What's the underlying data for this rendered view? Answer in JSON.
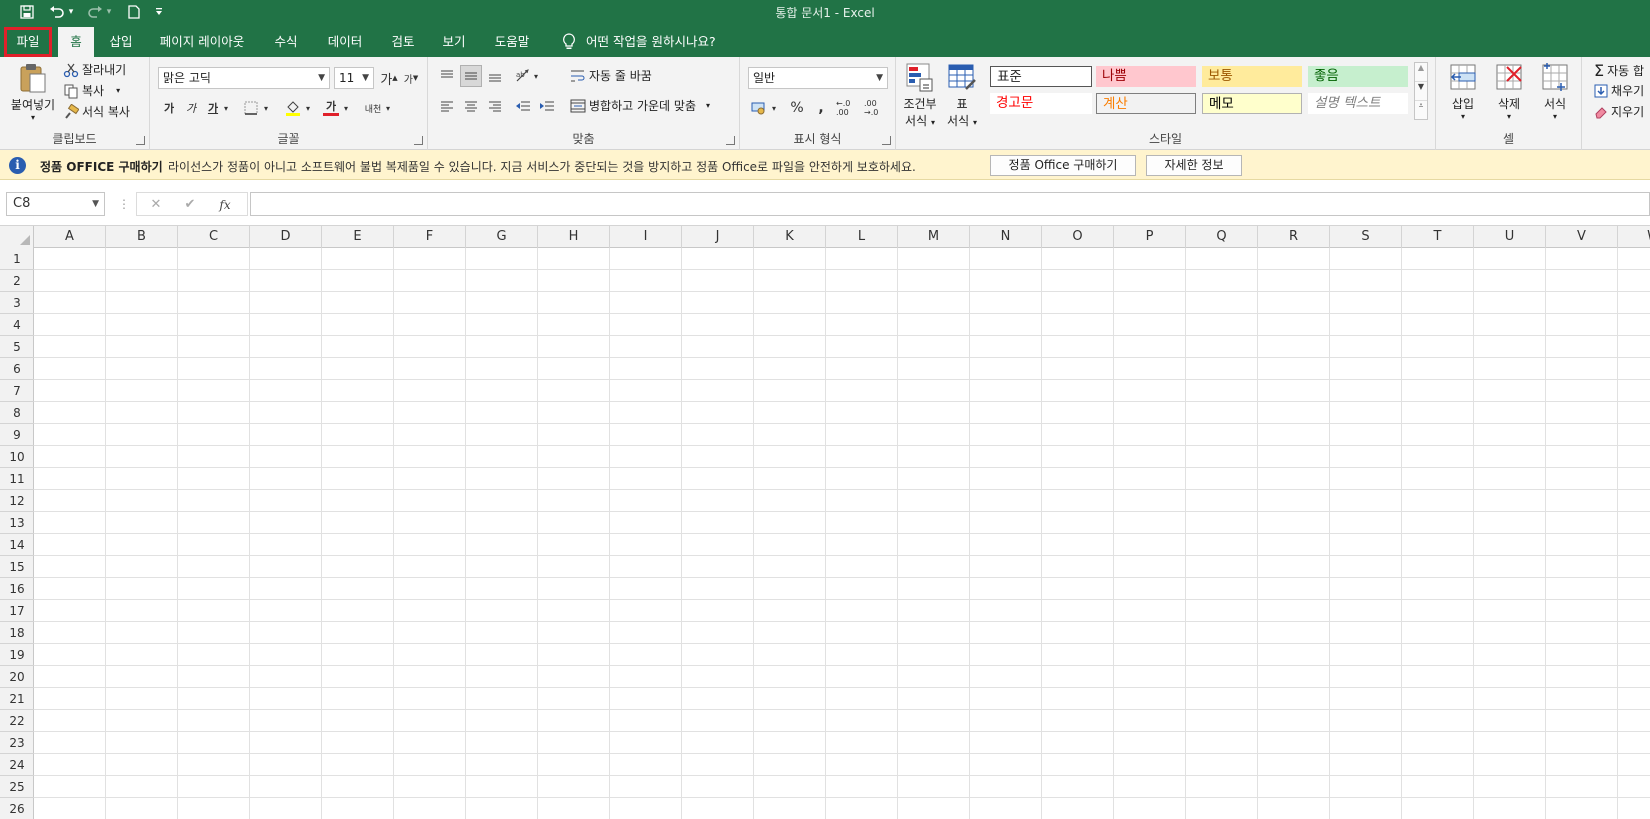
{
  "titlebar": {
    "title": "통합 문서1  -  Excel",
    "quick_access": [
      "save-icon",
      "undo-icon",
      "redo-icon",
      "new-document-icon",
      "customize-arrow-icon"
    ]
  },
  "tabs": [
    {
      "label": "파일"
    },
    {
      "label": "홈"
    },
    {
      "label": "삽입"
    },
    {
      "label": "페이지 레이아웃"
    },
    {
      "label": "수식"
    },
    {
      "label": "데이터"
    },
    {
      "label": "검토"
    },
    {
      "label": "보기"
    },
    {
      "label": "도움말"
    }
  ],
  "tellme": {
    "label": "어떤 작업을 원하시나요?"
  },
  "ribbon": {
    "clipboard": {
      "label": "클립보드",
      "paste": "붙여넣기",
      "cut": "잘라내기",
      "copy": "복사",
      "format_painter": "서식 복사"
    },
    "font": {
      "label": "글꼴",
      "font_name": "맑은 고딕",
      "font_size": "11",
      "bold": "가",
      "italic": "가",
      "underline": "가",
      "grow": "가",
      "shrink": "가",
      "font_color": "가",
      "phonetic": "내천"
    },
    "alignment": {
      "label": "맞춤",
      "wrap_text": "자동 줄 바꿈",
      "merge_center": "병합하고 가운데 맞춤"
    },
    "number": {
      "label": "표시 형식",
      "format": "일반",
      "percent": "%",
      "comma": ",",
      "increase_decimal": "←.0 .00",
      "decrease_decimal": ".00 →.0"
    },
    "styles": {
      "label": "스타일",
      "conditional_formatting_1": "조건부",
      "conditional_formatting_2": "서식",
      "format_as_table_1": "표",
      "format_as_table_2": "서식",
      "cells": [
        {
          "label": "표준",
          "color": "#000000",
          "bg": "#ffffff"
        },
        {
          "label": "나쁨",
          "color": "#9c0006",
          "bg": "#ffc7ce"
        },
        {
          "label": "보통",
          "color": "#9c5700",
          "bg": "#ffeb9c"
        },
        {
          "label": "좋음",
          "color": "#006100",
          "bg": "#c6efce"
        },
        {
          "label": "경고문",
          "color": "#ff0000",
          "bg": "#ffffff"
        },
        {
          "label": "계산",
          "color": "#fa7d00",
          "bg": "#f2f2f2"
        },
        {
          "label": "메모",
          "color": "#000000",
          "bg": "#ffffcc"
        },
        {
          "label": "설명 텍스트",
          "color": "#7f7f7f",
          "bg": "#ffffff"
        }
      ]
    },
    "cells_group": {
      "label": "셀",
      "insert": "삽입",
      "delete": "삭제",
      "format": "서식"
    },
    "editing": {
      "autosum": "자동 합",
      "fill": "채우기",
      "clear": "지우기"
    }
  },
  "messagebar": {
    "title": "정품 OFFICE 구매하기",
    "message": "라이선스가 정품이 아니고 소프트웨어 불법 복제품일 수 있습니다. 지금 서비스가 중단되는 것을 방지하고 정품 Office로 파일을 안전하게 보호하세요.",
    "buy_button": "정품 Office 구매하기",
    "details_button": "자세한 정보"
  },
  "formulabar": {
    "namebox": "C8",
    "cancel": "✕",
    "enter": "✔",
    "fx": "fx",
    "value": ""
  },
  "grid": {
    "columns": [
      "A",
      "B",
      "C",
      "D",
      "E",
      "F",
      "G",
      "H",
      "I",
      "J",
      "K",
      "L",
      "M",
      "N",
      "O",
      "P",
      "Q",
      "R",
      "S",
      "T",
      "U",
      "V",
      "W"
    ],
    "rows": [
      "1",
      "2",
      "3",
      "4",
      "5",
      "6",
      "7",
      "8",
      "9",
      "10",
      "11",
      "12",
      "13",
      "14",
      "15",
      "16",
      "17",
      "18",
      "19",
      "20",
      "21",
      "22",
      "23",
      "24",
      "25",
      "26"
    ]
  },
  "colors": {
    "brand": "#217346",
    "highlight": "#e0202a",
    "message_bg": "#fff4ce"
  }
}
